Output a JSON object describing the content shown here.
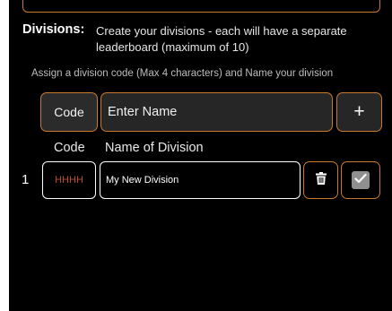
{
  "section": {
    "heading": "Divisions:",
    "description": "Create your divisions - each will have a separate leaderboard (maximum of 10)",
    "hint": "Assign a division code (Max 4 characters) and Name your division"
  },
  "add_row": {
    "code_label": "Code",
    "name_placeholder": "Enter Name",
    "add_label": "+"
  },
  "columns": {
    "code": "Code",
    "name": "Name of Division"
  },
  "divisions": [
    {
      "index": "1",
      "code_placeholder": "HHHH",
      "name_value": "My New Division",
      "checked": true
    }
  ],
  "icons": {
    "delete": "trash-icon",
    "confirm": "checkmark-icon"
  },
  "colors": {
    "background": "#000000",
    "accent_border": "#c97a2c",
    "code_placeholder": "#b8532f",
    "input_fill": "#262626"
  }
}
